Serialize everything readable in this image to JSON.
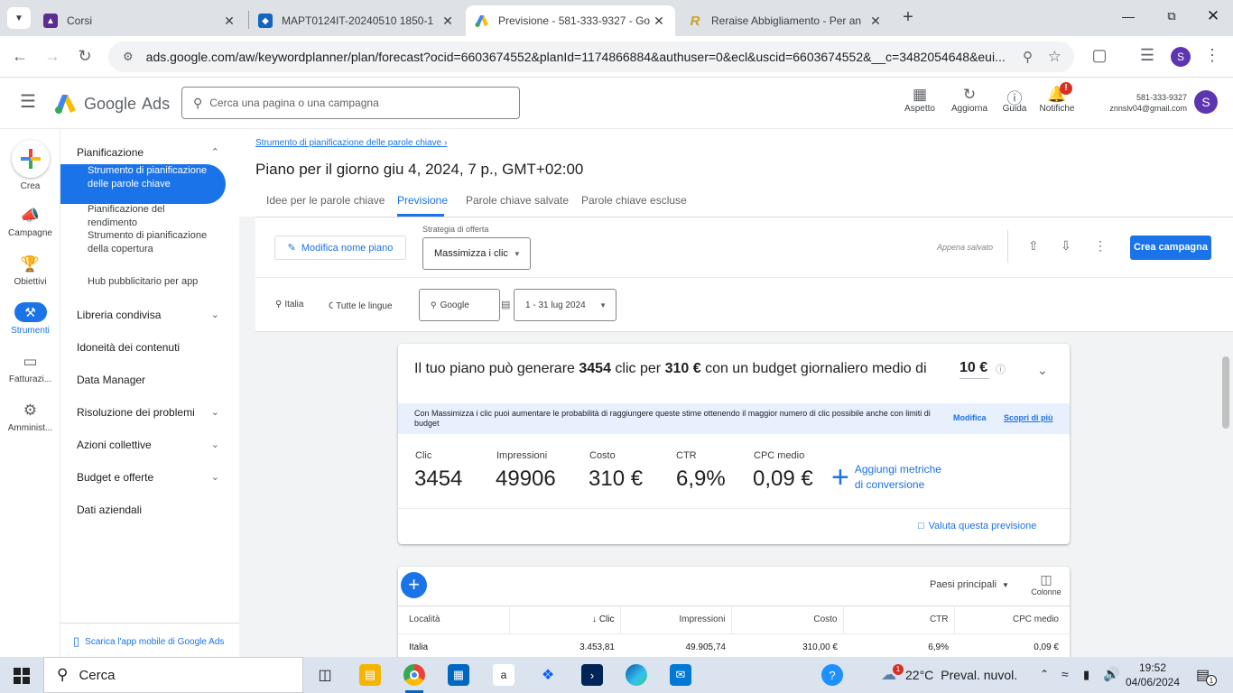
{
  "browser": {
    "tabs": [
      {
        "title": "Corsi",
        "favicon": "mentor-logo-icon"
      },
      {
        "title": "MAPT0124IT-20240510 1850-1",
        "favicon": "mapt-logo-icon"
      },
      {
        "title": "Previsione - 581-333-9327 - Go",
        "favicon": "google-ads-icon",
        "active": true
      },
      {
        "title": "Reraise Abbigliamento - Per an",
        "favicon": "reraise-logo-icon"
      }
    ],
    "url": "ads.google.com/aw/keywordplanner/plan/forecast?ocid=6603674552&planId=1174866884&authuser=0&ecl&uscid=6603674552&__c=3482054648&eui..."
  },
  "header": {
    "brand_google": "Google",
    "brand_ads": "Ads",
    "search_placeholder": "Cerca una pagina o una campagna",
    "actions": [
      {
        "label": "Aspetto",
        "icon": "appearance-icon"
      },
      {
        "label": "Aggiorna",
        "icon": "refresh-icon"
      },
      {
        "label": "Guida",
        "icon": "help-icon"
      },
      {
        "label": "Notifiche",
        "icon": "bell-icon",
        "badge": "!"
      }
    ],
    "account_id": "581-333-9327",
    "account_email": "znnslv04@gmail.com",
    "avatar_letter": "S"
  },
  "rail": {
    "items": [
      {
        "label": "Crea",
        "icon": "plus-icon"
      },
      {
        "label": "Campagne",
        "icon": "megaphone-icon"
      },
      {
        "label": "Obiettivi",
        "icon": "trophy-icon"
      },
      {
        "label": "Strumenti",
        "icon": "tools-icon",
        "active": true
      },
      {
        "label": "Fatturazi...",
        "icon": "card-icon"
      },
      {
        "label": "Amminist...",
        "icon": "gear-icon"
      }
    ]
  },
  "sidebar": {
    "sections": [
      {
        "label": "Pianificazione",
        "expanded": true
      },
      {
        "label": "Libreria condivisa"
      },
      {
        "label": "Idoneità dei contenuti"
      },
      {
        "label": "Data Manager"
      },
      {
        "label": "Risoluzione dei problemi"
      },
      {
        "label": "Azioni collettive"
      },
      {
        "label": "Budget e offerte"
      },
      {
        "label": "Dati aziendali"
      }
    ],
    "sub_items": [
      {
        "label": "Strumento di pianificazione delle parole chiave",
        "active": true
      },
      {
        "label": "Pianificazione del rendimento"
      },
      {
        "label": "Strumento di pianificazione della copertura"
      },
      {
        "label": "Hub pubblicitario per app"
      }
    ],
    "mobile_app_link": "Scarica l'app mobile di Google Ads"
  },
  "page": {
    "breadcrumb": "Strumento di pianificazione delle parole chiave",
    "title": "Piano per il giorno giu 4, 2024, 7 p., GMT+02:00",
    "tabs": [
      "Idee per le parole chiave",
      "Previsione",
      "Parole chiave salvate",
      "Parole chiave escluse"
    ],
    "active_tab": "Previsione",
    "edit_plan_label": "Modifica nome piano",
    "bid_strategy_label": "Strategia di offerta",
    "bid_strategy_value": "Massimizza i clic",
    "saved_status": "Appena salvato",
    "create_campaign": "Crea campagna",
    "filters": {
      "location": "Italia",
      "language": "Tutte le lingue",
      "network": "Google",
      "date_range": "1 - 31 lug 2024"
    }
  },
  "forecast": {
    "summary_pre": "Il tuo piano può generare",
    "summary_clicks": "3454",
    "summary_mid1": "clic per",
    "summary_cost": "310 €",
    "summary_mid2": "con un budget giornaliero medio di",
    "summary_budget": "10 €",
    "info_text": "Con Massimizza i clic puoi aumentare le probabilità di raggiungere queste stime ottenendo il maggior numero di clic possibile anche con limiti di budget",
    "info_edit": "Modifica",
    "info_learn": "Scopri di più",
    "metrics": [
      {
        "label": "Clic",
        "value": "3454"
      },
      {
        "label": "Impressioni",
        "value": "49906"
      },
      {
        "label": "Costo",
        "value": "310 €"
      },
      {
        "label": "CTR",
        "value": "6,9%"
      },
      {
        "label": "CPC medio",
        "value": "0,09 €"
      }
    ],
    "add_conversion_line1": "Aggiungi metriche",
    "add_conversion_line2": "di conversione",
    "rate_forecast": "Valuta questa previsione"
  },
  "table": {
    "dropdown": "Paesi principali",
    "columns_label": "Colonne",
    "headers": [
      "Località",
      "Clic",
      "Impressioni",
      "Costo",
      "CTR",
      "CPC medio"
    ],
    "rows": [
      [
        "Italia",
        "3.453,81",
        "49.905,74",
        "310,00 €",
        "6,9%",
        "0,09 €"
      ]
    ]
  },
  "taskbar": {
    "search_placeholder": "Cerca",
    "weather_temp": "22°C",
    "weather_desc": "Preval. nuvol.",
    "time": "19:52",
    "date": "04/06/2024",
    "notif_count": "1"
  }
}
